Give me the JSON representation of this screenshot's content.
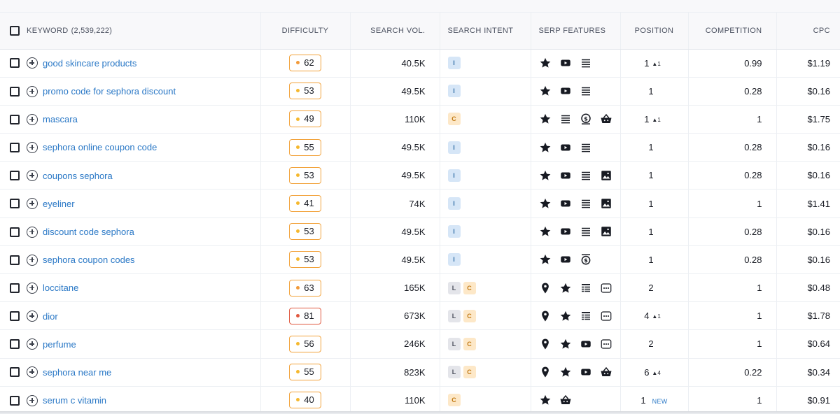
{
  "header": {
    "keyword_label": "KEYWORD",
    "keyword_count": "(2,539,222)",
    "difficulty": "DIFFICULTY",
    "search_vol": "SEARCH VOL.",
    "search_intent": "SEARCH INTENT",
    "serp_features": "SERP FEATURES",
    "position": "POSITION",
    "competition": "COMPETITION",
    "cpc": "CPC"
  },
  "colors": {
    "link": "#2a78c6",
    "difficulty_orange": "#f2a23a",
    "difficulty_red": "#e0583f",
    "intent_informational": "#d6e6f7",
    "intent_commercial": "#fde8c8",
    "intent_local": "#e4e5ea"
  },
  "rows": [
    {
      "keyword": "good skincare products",
      "difficulty": "62",
      "diff_level": "orange",
      "volume": "40.5K",
      "intents": [
        "I"
      ],
      "serp": [
        "star-icon",
        "video-icon",
        "list-icon"
      ],
      "position": "1",
      "pos_change": "▲1",
      "pos_new": "",
      "competition": "0.99",
      "cpc": "$1.19"
    },
    {
      "keyword": "promo code for sephora discount",
      "difficulty": "53",
      "diff_level": "yellow",
      "volume": "49.5K",
      "intents": [
        "I"
      ],
      "serp": [
        "star-icon",
        "video-icon",
        "list-icon"
      ],
      "position": "1",
      "pos_change": "",
      "pos_new": "",
      "competition": "0.28",
      "cpc": "$0.16"
    },
    {
      "keyword": "mascara",
      "difficulty": "49",
      "diff_level": "yellow",
      "volume": "110K",
      "intents": [
        "C"
      ],
      "serp": [
        "star-icon",
        "list-icon",
        "ad-icon",
        "shopping-basket-icon"
      ],
      "position": "1",
      "pos_change": "▲1",
      "pos_new": "",
      "competition": "1",
      "cpc": "$1.75"
    },
    {
      "keyword": "sephora online coupon code",
      "difficulty": "55",
      "diff_level": "yellow",
      "volume": "49.5K",
      "intents": [
        "I"
      ],
      "serp": [
        "star-icon",
        "video-icon",
        "list-icon"
      ],
      "position": "1",
      "pos_change": "",
      "pos_new": "",
      "competition": "0.28",
      "cpc": "$0.16"
    },
    {
      "keyword": "coupons sephora",
      "difficulty": "53",
      "diff_level": "yellow",
      "volume": "49.5K",
      "intents": [
        "I"
      ],
      "serp": [
        "star-icon",
        "video-icon",
        "list-icon",
        "image-icon"
      ],
      "position": "1",
      "pos_change": "",
      "pos_new": "",
      "competition": "0.28",
      "cpc": "$0.16"
    },
    {
      "keyword": "eyeliner",
      "difficulty": "41",
      "diff_level": "yellow",
      "volume": "74K",
      "intents": [
        "I"
      ],
      "serp": [
        "star-icon",
        "video-icon",
        "list-icon",
        "image-icon"
      ],
      "position": "1",
      "pos_change": "",
      "pos_new": "",
      "competition": "1",
      "cpc": "$1.41"
    },
    {
      "keyword": "discount code sephora",
      "difficulty": "53",
      "diff_level": "yellow",
      "volume": "49.5K",
      "intents": [
        "I"
      ],
      "serp": [
        "star-icon",
        "video-icon",
        "list-icon",
        "image-icon"
      ],
      "position": "1",
      "pos_change": "",
      "pos_new": "",
      "competition": "0.28",
      "cpc": "$0.16"
    },
    {
      "keyword": "sephora coupon codes",
      "difficulty": "53",
      "diff_level": "yellow",
      "volume": "49.5K",
      "intents": [
        "I"
      ],
      "serp": [
        "star-icon",
        "video-icon",
        "top-ad-icon"
      ],
      "position": "1",
      "pos_change": "",
      "pos_new": "",
      "competition": "0.28",
      "cpc": "$0.16"
    },
    {
      "keyword": "loccitane",
      "difficulty": "63",
      "diff_level": "orange",
      "volume": "165K",
      "intents": [
        "L",
        "C"
      ],
      "serp": [
        "map-pin-icon",
        "star-icon",
        "table-icon",
        "more-icon"
      ],
      "position": "2",
      "pos_change": "",
      "pos_new": "",
      "competition": "1",
      "cpc": "$0.48"
    },
    {
      "keyword": "dior",
      "difficulty": "81",
      "diff_level": "red",
      "volume": "673K",
      "intents": [
        "L",
        "C"
      ],
      "serp": [
        "map-pin-icon",
        "star-icon",
        "table-icon",
        "more-icon"
      ],
      "position": "4",
      "pos_change": "▲1",
      "pos_new": "",
      "competition": "1",
      "cpc": "$1.78"
    },
    {
      "keyword": "perfume",
      "difficulty": "56",
      "diff_level": "yellow",
      "volume": "246K",
      "intents": [
        "L",
        "C"
      ],
      "serp": [
        "map-pin-icon",
        "star-icon",
        "video-icon",
        "more-icon"
      ],
      "position": "2",
      "pos_change": "",
      "pos_new": "",
      "competition": "1",
      "cpc": "$0.64"
    },
    {
      "keyword": "sephora near me",
      "difficulty": "55",
      "diff_level": "yellow",
      "volume": "823K",
      "intents": [
        "L",
        "C"
      ],
      "serp": [
        "map-pin-icon",
        "star-icon",
        "video-icon",
        "shopping-basket-icon"
      ],
      "position": "6",
      "pos_change": "▲4",
      "pos_new": "",
      "competition": "0.22",
      "cpc": "$0.34"
    },
    {
      "keyword": "serum c vitamin",
      "difficulty": "40",
      "diff_level": "yellow",
      "volume": "110K",
      "intents": [
        "C"
      ],
      "serp": [
        "star-icon",
        "shopping-basket-icon"
      ],
      "position": "1",
      "pos_change": "",
      "pos_new": "NEW",
      "competition": "1",
      "cpc": "$0.91"
    }
  ]
}
